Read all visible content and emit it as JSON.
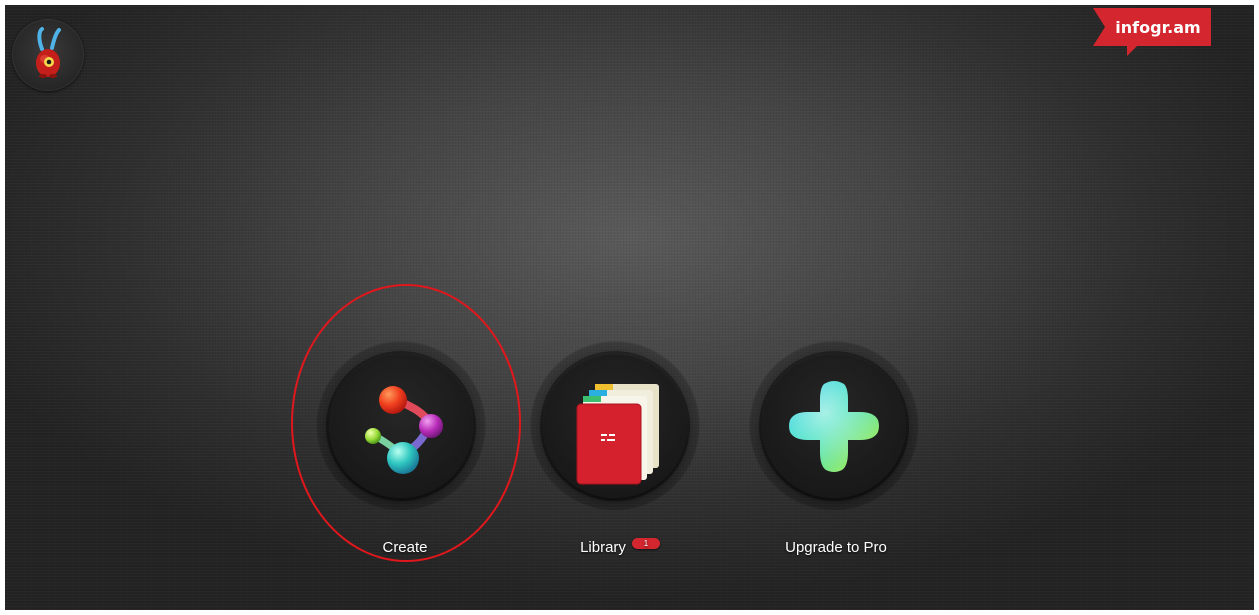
{
  "header": {
    "brand_label": "infogr.am",
    "brand_color": "#d3262e",
    "avatar_icon": "bunny-mascot-icon"
  },
  "menu": {
    "items": [
      {
        "label": "Create",
        "icon": "molecule-icon",
        "badge": ""
      },
      {
        "label": "Library",
        "icon": "folders-icon",
        "badge": "1"
      },
      {
        "label": "Upgrade to Pro",
        "icon": "plus-icon",
        "badge": ""
      }
    ]
  },
  "annotation": {
    "target": "Create",
    "color": "#e0171c"
  }
}
